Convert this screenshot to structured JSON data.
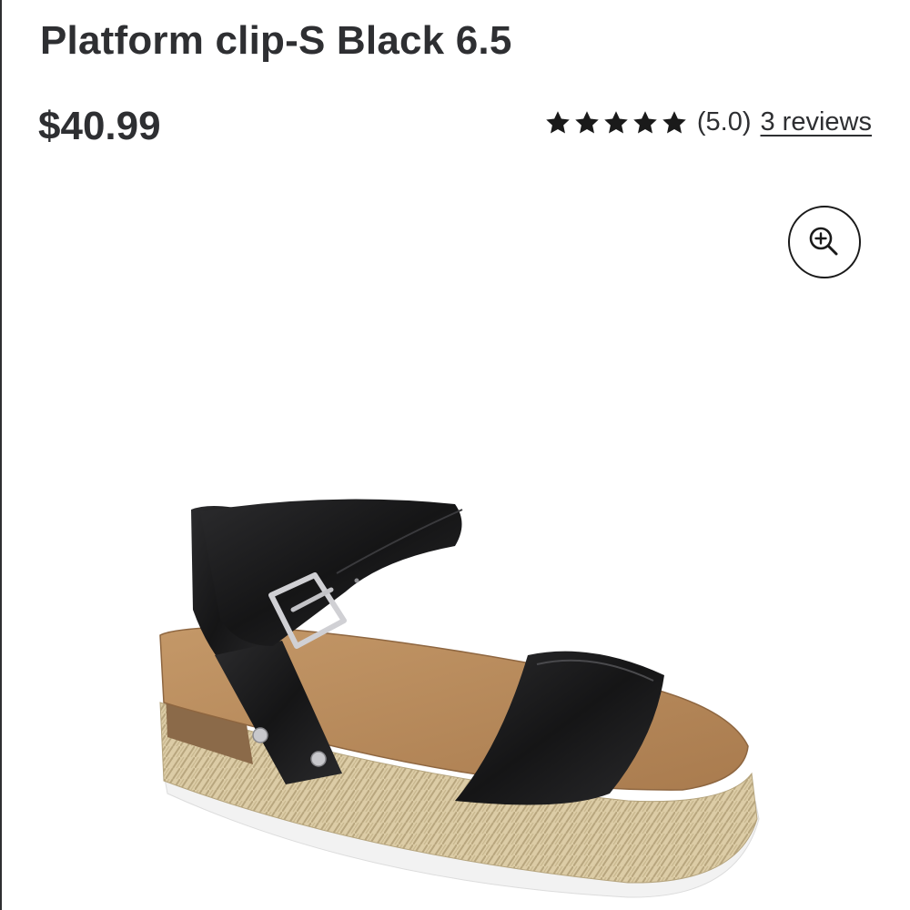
{
  "header": {
    "cut_text": "· · · · · · · · · · · · ·",
    "title": "Platform clip-S Black 6.5"
  },
  "product": {
    "price": "$40.99",
    "rating": {
      "stars": 5,
      "value_text": "(5.0)",
      "reviews_label": "3 reviews"
    },
    "image": {
      "subject": "black ankle-strap platform sandal with espadrille sole"
    }
  },
  "icons": {
    "zoom": "zoom-in-icon",
    "star": "star-icon"
  },
  "colors": {
    "text": "#2e2f32",
    "strap": "#1c1c1d",
    "footbed": "#b98a5e",
    "jute": "#d9c9a3",
    "buckle": "#c8c8cc"
  }
}
